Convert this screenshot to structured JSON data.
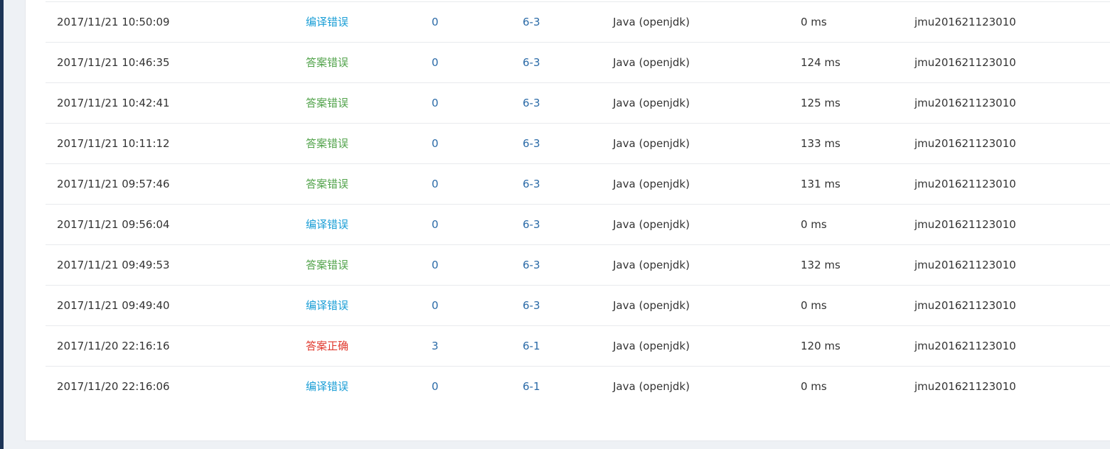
{
  "submissions": [
    {
      "time": "2017/11/21 10:50:09",
      "status": "编译错误",
      "status_type": "compile",
      "score": "0",
      "problem": "6-3",
      "language": "Java (openjdk)",
      "runtime": "0 ms",
      "user": "jmu201621123010"
    },
    {
      "time": "2017/11/21 10:46:35",
      "status": "答案错误",
      "status_type": "wrong",
      "score": "0",
      "problem": "6-3",
      "language": "Java (openjdk)",
      "runtime": "124 ms",
      "user": "jmu201621123010"
    },
    {
      "time": "2017/11/21 10:42:41",
      "status": "答案错误",
      "status_type": "wrong",
      "score": "0",
      "problem": "6-3",
      "language": "Java (openjdk)",
      "runtime": "125 ms",
      "user": "jmu201621123010"
    },
    {
      "time": "2017/11/21 10:11:12",
      "status": "答案错误",
      "status_type": "wrong",
      "score": "0",
      "problem": "6-3",
      "language": "Java (openjdk)",
      "runtime": "133 ms",
      "user": "jmu201621123010"
    },
    {
      "time": "2017/11/21 09:57:46",
      "status": "答案错误",
      "status_type": "wrong",
      "score": "0",
      "problem": "6-3",
      "language": "Java (openjdk)",
      "runtime": "131 ms",
      "user": "jmu201621123010"
    },
    {
      "time": "2017/11/21 09:56:04",
      "status": "编译错误",
      "status_type": "compile",
      "score": "0",
      "problem": "6-3",
      "language": "Java (openjdk)",
      "runtime": "0 ms",
      "user": "jmu201621123010"
    },
    {
      "time": "2017/11/21 09:49:53",
      "status": "答案错误",
      "status_type": "wrong",
      "score": "0",
      "problem": "6-3",
      "language": "Java (openjdk)",
      "runtime": "132 ms",
      "user": "jmu201621123010"
    },
    {
      "time": "2017/11/21 09:49:40",
      "status": "编译错误",
      "status_type": "compile",
      "score": "0",
      "problem": "6-3",
      "language": "Java (openjdk)",
      "runtime": "0 ms",
      "user": "jmu201621123010"
    },
    {
      "time": "2017/11/20 22:16:16",
      "status": "答案正确",
      "status_type": "correct",
      "score": "3",
      "problem": "6-1",
      "language": "Java (openjdk)",
      "runtime": "120 ms",
      "user": "jmu201621123010"
    },
    {
      "time": "2017/11/20 22:16:06",
      "status": "编译错误",
      "status_type": "compile",
      "score": "0",
      "problem": "6-1",
      "language": "Java (openjdk)",
      "runtime": "0 ms",
      "user": "jmu201621123010"
    }
  ],
  "colors": {
    "compile": "#1a9ed6",
    "wrong": "#52a34b",
    "correct": "#e0392e",
    "link": "#2a6aa7"
  }
}
